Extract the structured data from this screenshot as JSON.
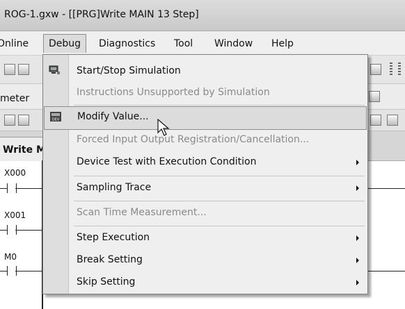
{
  "window": {
    "title": "ROG-1.gxw - [[PRG]Write MAIN 13 Step]"
  },
  "menubar": {
    "items": [
      {
        "label": "Online",
        "name": "menu-online"
      },
      {
        "label": "Debug",
        "name": "menu-debug"
      },
      {
        "label": "Diagnostics",
        "name": "menu-diagnostics"
      },
      {
        "label": "Tool",
        "name": "menu-tool"
      },
      {
        "label": "Window",
        "name": "menu-window"
      },
      {
        "label": "Help",
        "name": "menu-help"
      }
    ]
  },
  "toolbar": {
    "meter_label": "meter"
  },
  "editor": {
    "tab_label": "Write M",
    "rungs": [
      {
        "device": "X000"
      },
      {
        "device": "X001"
      },
      {
        "device": "M0"
      }
    ]
  },
  "debug_menu": {
    "items": [
      {
        "label": "Start/Stop Simulation",
        "enabled": true,
        "submenu": false,
        "icon": "simulation-icon"
      },
      {
        "label": "Instructions Unsupported by Simulation",
        "enabled": false,
        "submenu": false
      },
      {
        "label": "Modify Value...",
        "enabled": true,
        "submenu": false,
        "highlighted": true,
        "icon": "device-modify-icon"
      },
      {
        "label": "Forced Input Output Registration/Cancellation...",
        "enabled": false,
        "submenu": false
      },
      {
        "label": "Device Test with Execution Condition",
        "enabled": true,
        "submenu": true
      },
      {
        "label": "Sampling Trace",
        "enabled": true,
        "submenu": true
      },
      {
        "label": "Scan Time Measurement...",
        "enabled": false,
        "submenu": false
      },
      {
        "label": "Step Execution",
        "enabled": true,
        "submenu": true
      },
      {
        "label": "Break Setting",
        "enabled": true,
        "submenu": true
      },
      {
        "label": "Skip Setting",
        "enabled": true,
        "submenu": true
      }
    ]
  },
  "colors": {
    "menu_bg": "#efefef",
    "highlight_bg": "#dcdcdc",
    "disabled_text": "#8a8a8a"
  }
}
